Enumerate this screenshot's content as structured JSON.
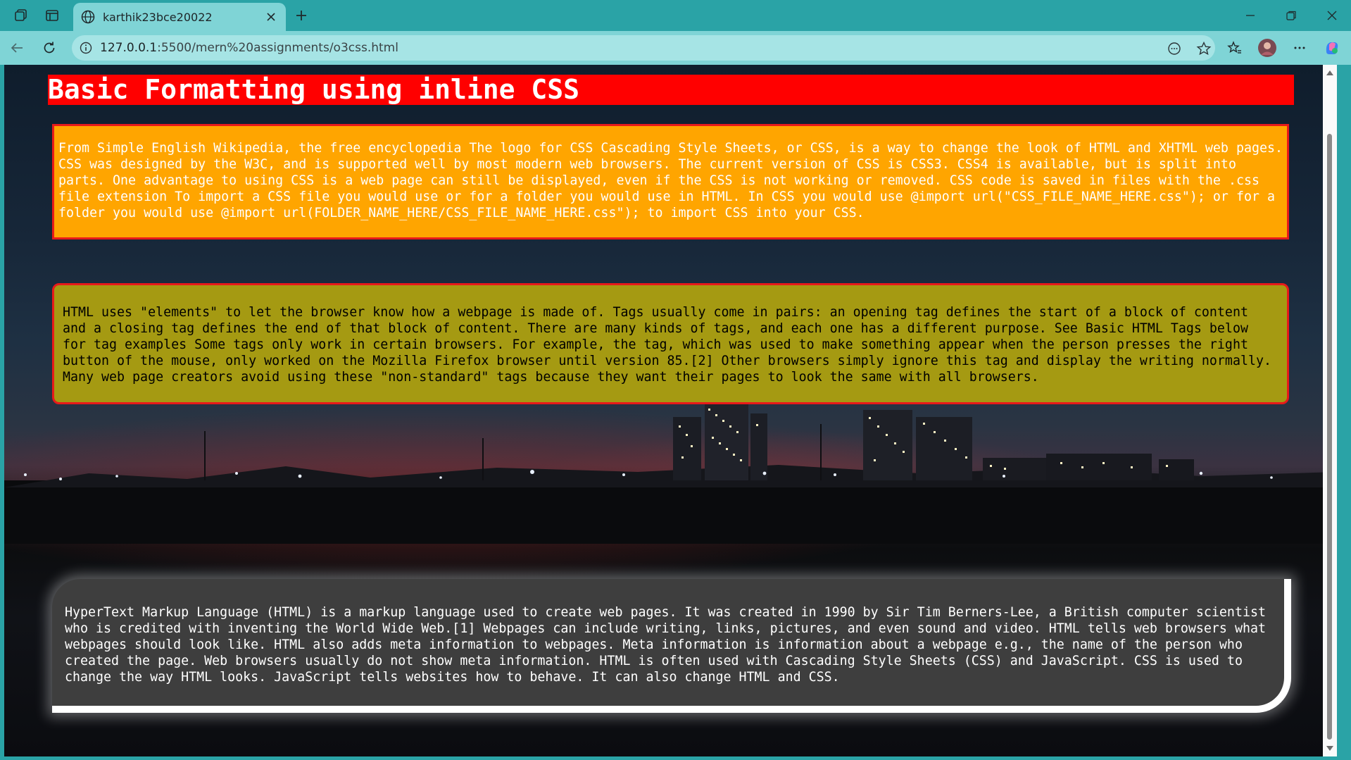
{
  "browser": {
    "tab_title": "karthik23bce20022",
    "url_host": "127.0.0.1",
    "url_path": ":5500/mern%20assignments/o3css.html"
  },
  "page": {
    "heading": "Basic Formatting using inline CSS",
    "paragraph1": "From Simple English Wikipedia, the free encyclopedia The logo for CSS Cascading Style Sheets, or CSS, is a way to change the look of HTML and XHTML web pages. CSS was designed by the W3C, and is supported well by most modern web browsers. The current version of CSS is CSS3. CSS4 is available, but is split into parts. One advantage to using CSS is a web page can still be displayed, even if the CSS is not working or removed. CSS code is saved in files with the .css file extension To import a CSS file you would use or for a folder you would use in HTML. In CSS you would use @import url(\"CSS_FILE_NAME_HERE.css\"); or for a folder you would use @import url(FOLDER_NAME_HERE/CSS_FILE_NAME_HERE.css\"); to import CSS into your CSS.",
    "paragraph2": "HTML uses \"elements\" to let the browser know how a webpage is made of. Tags usually come in pairs: an opening tag defines the start of a block of content and a closing tag defines the end of that block of content. There are many kinds of tags, and each one has a different purpose. See Basic HTML Tags below for tag examples Some tags only work in certain browsers. For example, the tag, which was used to make something appear when the person presses the right button of the mouse, only worked on the Mozilla Firefox browser until version 85.[2] Other browsers simply ignore this tag and display the writing normally. Many web page creators avoid using these \"non-standard\" tags because they want their pages to look the same with all browsers.",
    "paragraph3": "HyperText Markup Language (HTML) is a markup language used to create web pages. It was created in 1990 by Sir Tim Berners-Lee, a British computer scientist who is credited with inventing the World Wide Web.[1] Webpages can include writing, links, pictures, and even sound and video. HTML tells web browsers what webpages should look like. HTML also adds meta information to webpages. Meta information is information about a webpage e.g., the name of the person who created the page. Web browsers usually do not show meta information. HTML is often used with Cascading Style Sheets (CSS) and JavaScript. CSS is used to change the way HTML looks. JavaScript tells websites how to behave. It can also change HTML and CSS."
  },
  "colors": {
    "heading_bg": "#ff0000",
    "box1_bg": "#ffa500",
    "box2_bg": "#a59a12",
    "box3_bg": "#3e3e3e",
    "border": "#e81a1a",
    "browser_accent": "#2aa3a6"
  },
  "icons": {
    "tab_actions": "tab-actions-icon",
    "vertical_tabs": "vertical-tabs-icon",
    "favicon": "globe-icon",
    "close_tab": "close-icon",
    "new_tab": "plus-icon",
    "minimize": "minimize-icon",
    "restore": "restore-icon",
    "close_window": "close-window-icon",
    "back": "back-arrow-icon",
    "reload": "reload-icon",
    "site_info": "info-icon",
    "read_aloud": "reader-icon",
    "favorite": "star-icon",
    "favorites": "favorites-icon",
    "profile": "avatar",
    "more": "more-icon",
    "copilot": "copilot-icon"
  }
}
